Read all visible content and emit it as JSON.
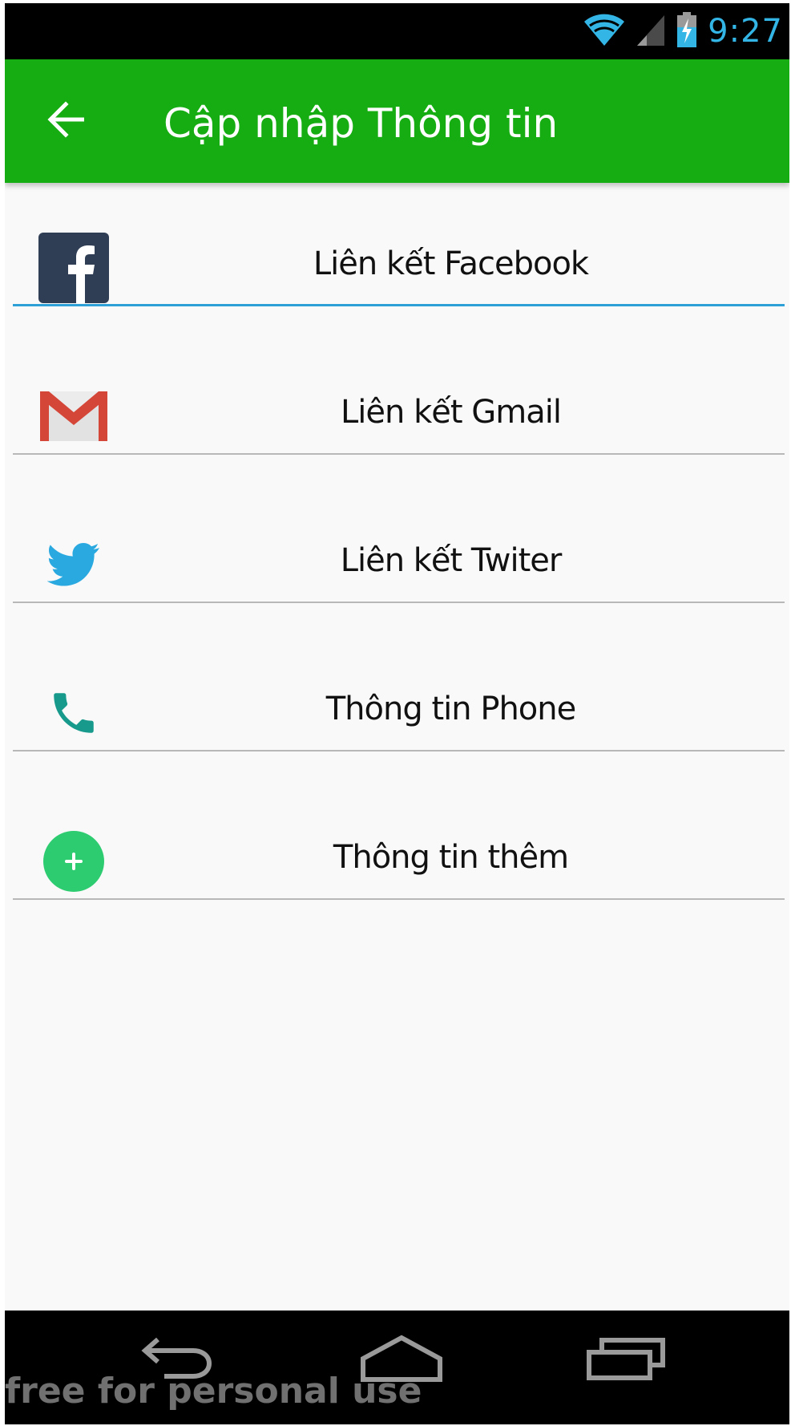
{
  "status_bar": {
    "time": "9:27",
    "icons": [
      "wifi-icon",
      "cellular-signal-icon",
      "battery-charging-icon"
    ]
  },
  "app_bar": {
    "title": "Cập nhập Thông tin",
    "back_icon": "arrow-left-icon"
  },
  "list": {
    "items": [
      {
        "label": "Liên kết Facebook",
        "icon": "facebook-icon",
        "active": true
      },
      {
        "label": "Liên kết Gmail",
        "icon": "gmail-icon",
        "active": false
      },
      {
        "label": "Liên kết Twiter",
        "icon": "twitter-icon",
        "active": false
      },
      {
        "label": "Thông tin Phone",
        "icon": "phone-icon",
        "active": false
      },
      {
        "label": "Thông tin thêm",
        "icon": "add-circle-icon",
        "active": false
      }
    ]
  },
  "nav_bar": {
    "buttons": [
      "back-nav-icon",
      "home-nav-icon",
      "recents-nav-icon"
    ]
  },
  "watermark": "free for personal use",
  "colors": {
    "app_bar": "#16ad13",
    "status_time": "#33b5e5",
    "active_underline": "#2ea0d8",
    "facebook": "#2f3e55",
    "gmail": "#d44638",
    "twitter": "#2aa9e0",
    "phone": "#179a8c",
    "add": "#2ecc71"
  }
}
